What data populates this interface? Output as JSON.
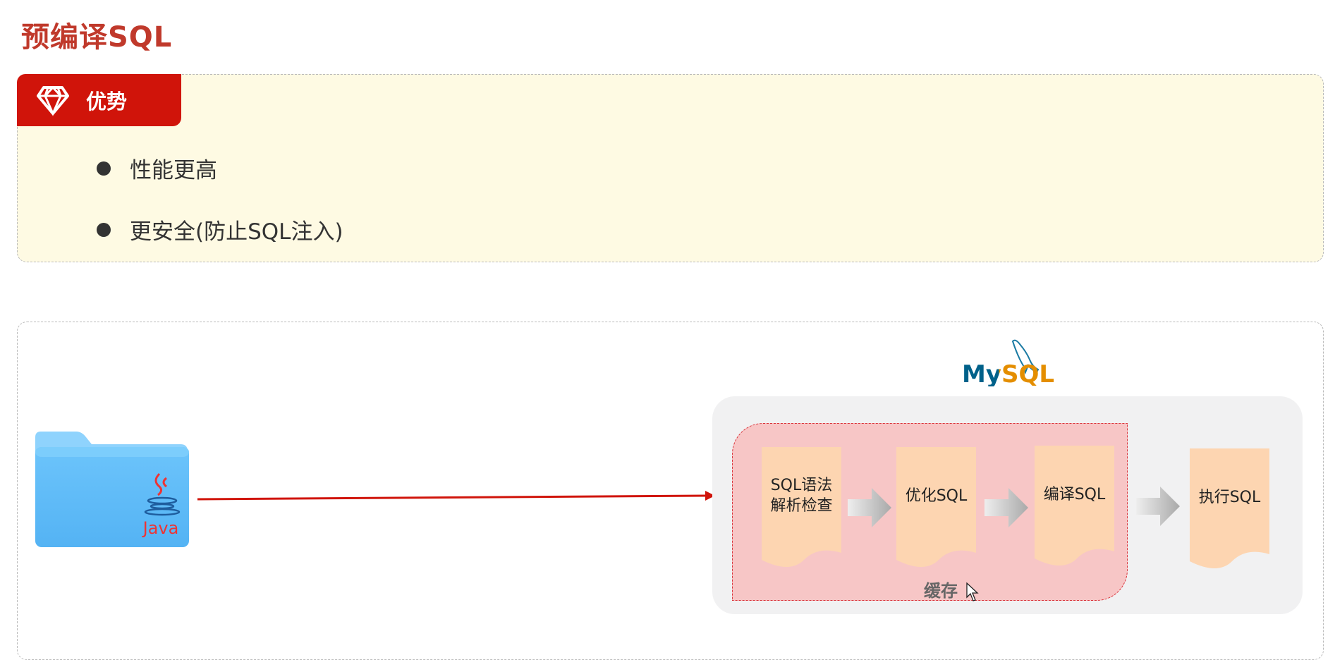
{
  "title": "预编译SQL",
  "advantages": {
    "tab_label": "优势",
    "tab_icon": "diamond-icon",
    "items": [
      "性能更高",
      "更安全(防止SQL注入)"
    ]
  },
  "diagram": {
    "client_icon": "java-folder-icon",
    "client_logo_text": "Java",
    "server_logo_text": "MySQL",
    "cache_label": "缓存",
    "steps": [
      {
        "label_line1": "SQL语法",
        "label_line2": "解析检查"
      },
      {
        "label_line1": "优化SQL",
        "label_line2": ""
      },
      {
        "label_line1": "编译SQL",
        "label_line2": ""
      },
      {
        "label_line1": "执行SQL",
        "label_line2": ""
      }
    ]
  },
  "colors": {
    "title": "#c0392b",
    "tab": "#d0140a",
    "panel_bg": "#fefae3",
    "cache_bg": "#f7c6c6",
    "doc_fill": "#fdd5b1",
    "arrow": "#d0140a"
  }
}
